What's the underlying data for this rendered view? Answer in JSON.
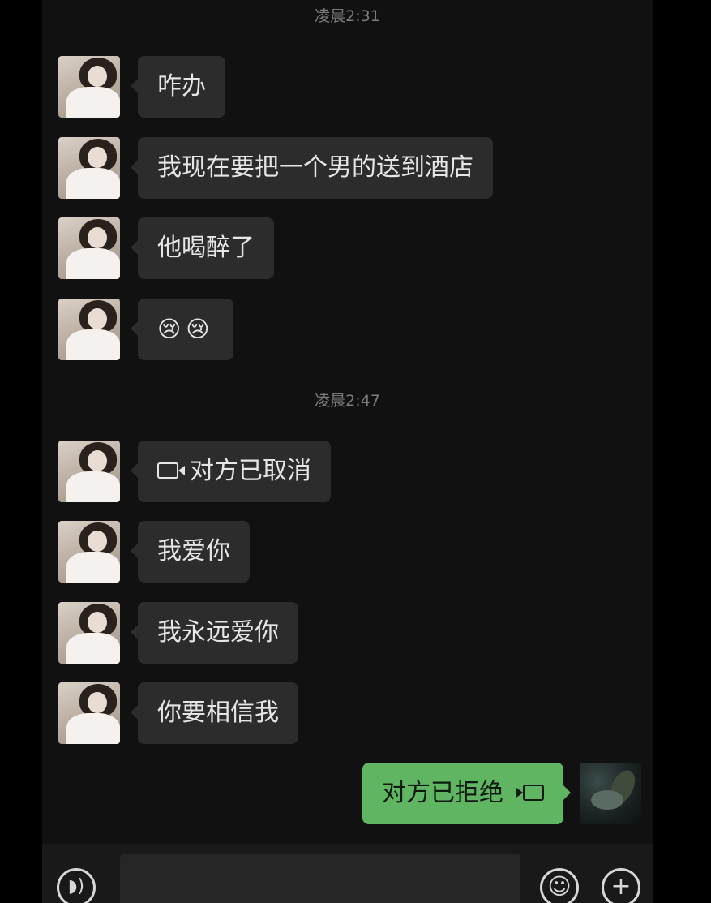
{
  "timestamps": [
    "凌晨2:31",
    "凌晨2:47"
  ],
  "received_messages": [
    {
      "text": "咋办"
    },
    {
      "text": "我现在要把一个男的送到酒店"
    },
    {
      "text": "他喝醉了"
    },
    {
      "text": "😢😢",
      "type": "emoji"
    },
    {
      "text": "对方已取消",
      "type": "video-call-cancelled",
      "icon": "video-camera-icon"
    },
    {
      "text": "我爱你"
    },
    {
      "text": "我永远爱你"
    },
    {
      "text": "你要相信我"
    }
  ],
  "sent_messages": [
    {
      "text": "对方已拒绝",
      "type": "video-call-rejected",
      "icon": "video-camera-icon"
    }
  ],
  "input_bar": {
    "voice_icon": "voice-icon",
    "emoji_icon": "emoji-icon",
    "plus_icon": "plus-icon"
  },
  "colors": {
    "background": "#111111",
    "received_bubble": "#2c2c2c",
    "sent_bubble": "#5fb562",
    "timestamp_text": "#7c7c7c"
  }
}
